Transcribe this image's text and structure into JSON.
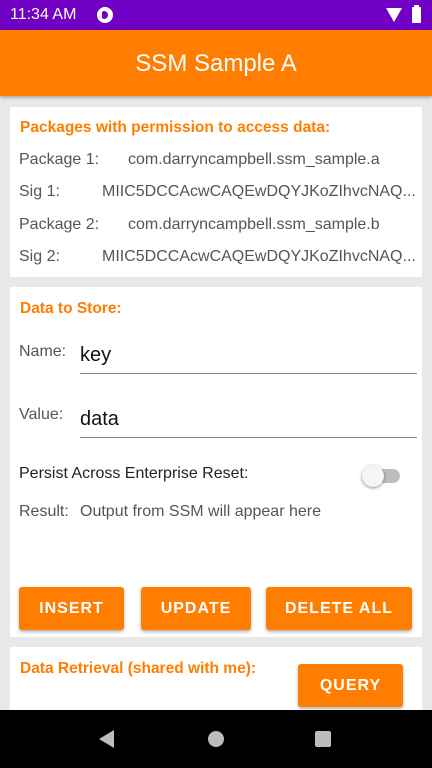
{
  "status_bar": {
    "time": "11:34 AM"
  },
  "app_bar": {
    "title": "SSM Sample A"
  },
  "packages": {
    "title": "Packages with permission to access data:",
    "rows": [
      {
        "label": "Package 1:",
        "value": "com.darryncampbell.ssm_sample.a"
      },
      {
        "label": "Sig 1:",
        "value": "MIIC5DCCAcwCAQEwDQYJKoZIhvcNAQ..."
      },
      {
        "label": "Package 2:",
        "value": "com.darryncampbell.ssm_sample.b"
      },
      {
        "label": "Sig 2:",
        "value": "MIIC5DCCAcwCAQEwDQYJKoZIhvcNAQ..."
      }
    ]
  },
  "store": {
    "title": "Data to Store:",
    "name_label": "Name:",
    "name_value": "key",
    "value_label": "Value:",
    "value_value": "data",
    "persist_label": "Persist Across Enterprise Reset:",
    "persist_on": false,
    "result_label": "Result:",
    "result_text": "Output from SSM will appear here",
    "insert_label": "INSERT",
    "update_label": "UPDATE",
    "delete_all_label": "DELETE ALL"
  },
  "retrieval": {
    "title": "Data Retrieval (shared with me):",
    "query_label": "QUERY"
  },
  "colors": {
    "accent": "#ff7d00",
    "status_bar": "#6f00c4"
  },
  "icons": {
    "status": [
      "app-notification-icon",
      "wifi-icon",
      "battery-icon"
    ],
    "nav": [
      "back-icon",
      "home-icon",
      "recents-icon"
    ]
  }
}
